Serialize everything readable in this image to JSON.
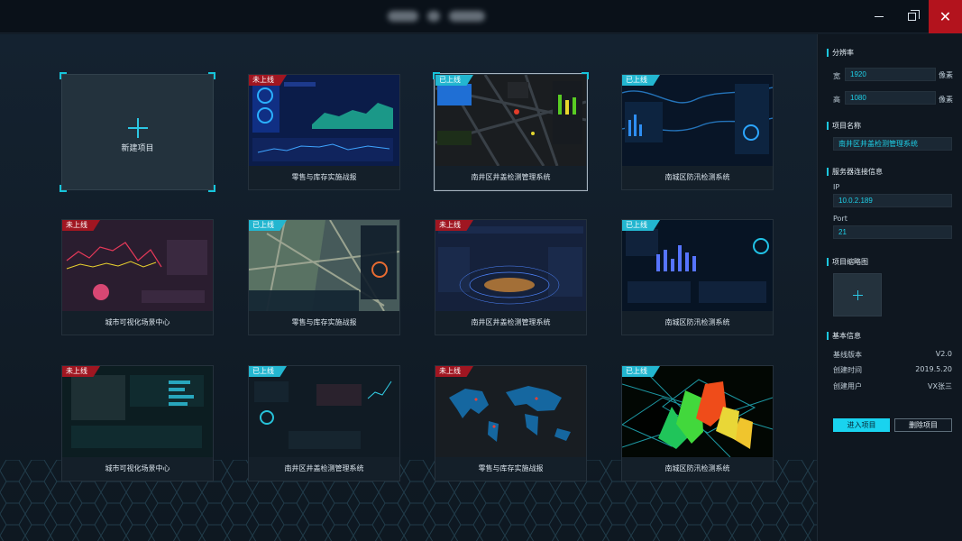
{
  "window": {
    "title": "",
    "controls": {
      "minimize": "minimize-icon",
      "maximize": "maximize-icon",
      "close": "close-icon"
    }
  },
  "grid": {
    "new_project_label": "新建项目",
    "projects": [
      {
        "status": "未上线",
        "title": "零售与库存实施战报",
        "status_color": "#a01621"
      },
      {
        "status": "已上线",
        "title": "南井区井盖检测管理系统",
        "status_color": "#23b6d0"
      },
      {
        "status": "已上线",
        "title": "南城区防汛检测系统",
        "status_color": "#23b6d0"
      },
      {
        "status": "未上线",
        "title": "城市可视化场景中心",
        "status_color": "#a01621"
      },
      {
        "status": "已上线",
        "title": "零售与库存实施战报",
        "status_color": "#23b6d0"
      },
      {
        "status": "未上线",
        "title": "南井区井盖检测管理系统",
        "status_color": "#a01621"
      },
      {
        "status": "已上线",
        "title": "南城区防汛检测系统",
        "status_color": "#23b6d0"
      },
      {
        "status": "未上线",
        "title": "城市可视化场景中心",
        "status_color": "#a01621"
      },
      {
        "status": "已上线",
        "title": "南井区井盖检测管理系统",
        "status_color": "#23b6d0"
      },
      {
        "status": "未上线",
        "title": "零售与库存实施战报",
        "status_color": "#a01621"
      },
      {
        "status": "已上线",
        "title": "南城区防汛检测系统",
        "status_color": "#23b6d0"
      }
    ]
  },
  "sidebar": {
    "resolution_title": "分辨率",
    "width_label": "宽",
    "width_value": "1920",
    "height_label": "高",
    "height_value": "1080",
    "unit": "像素",
    "project_name_title": "项目名称",
    "project_name_value": "南井区井盖检测管理系统",
    "server_title": "服务器连接信息",
    "ip_label": "IP",
    "ip_value": "10.0.2.189",
    "port_label": "Port",
    "port_value": "21",
    "thumbnail_title": "项目缩略图",
    "basic_info_title": "基本信息",
    "base_version_label": "基线版本",
    "base_version_value": "V2.0",
    "created_time_label": "创建时间",
    "created_time_value": "2019.5.20",
    "created_user_label": "创建用户",
    "created_user_value": "VX张三",
    "enter_button": "进入项目",
    "delete_button": "删除项目"
  },
  "colors": {
    "accent": "#19d3ef",
    "offline": "#a01621",
    "online": "#23b6d0"
  }
}
